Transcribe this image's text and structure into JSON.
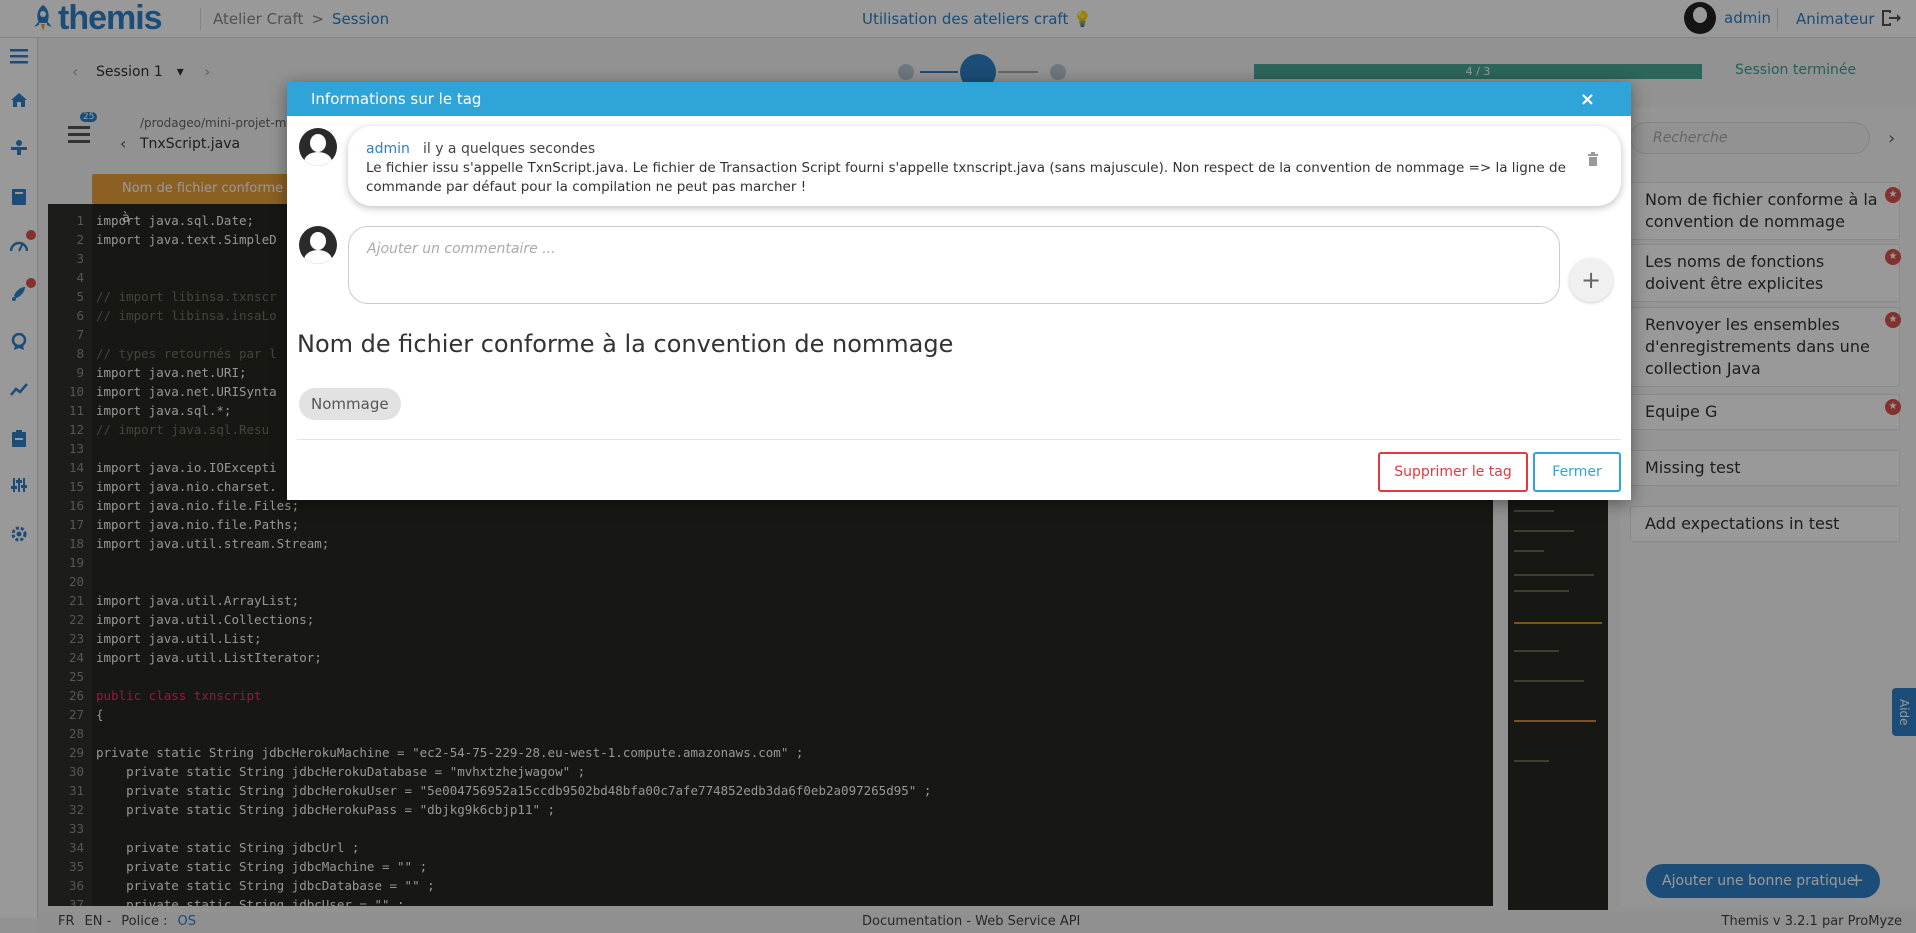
{
  "app": {
    "logo_text": "themis",
    "breadcrumb": [
      "Atelier Craft",
      ">",
      "Session"
    ],
    "center_title": "Utilisation des ateliers craft 💡",
    "user": "admin",
    "role": "Animateur"
  },
  "session": {
    "select_label": "Session 1",
    "progress_text": "4 / 3",
    "progress_value": 1.0,
    "status": "Session terminée"
  },
  "editor": {
    "file_path": "/prodageo/mini-projet-m",
    "file_name": "TnxScript.java",
    "tag_badge": "Nom de fichier conforme à",
    "file_count": "25",
    "lines": [
      {
        "n": "1",
        "t": "import java.sql.Date;",
        "k": "code"
      },
      {
        "n": "2",
        "t": "import java.text.SimpleD",
        "k": "code"
      },
      {
        "n": "3",
        "t": "",
        "k": "code"
      },
      {
        "n": "4",
        "t": "",
        "k": "code"
      },
      {
        "n": "5",
        "t": "// import libinsa.txnscr",
        "k": "comment"
      },
      {
        "n": "6",
        "t": "// import libinsa.insaLo",
        "k": "comment"
      },
      {
        "n": "7",
        "t": "",
        "k": "code"
      },
      {
        "n": "8",
        "t": "// types retournés par l",
        "k": "comment"
      },
      {
        "n": "9",
        "t": "import java.net.URI;",
        "k": "code"
      },
      {
        "n": "10",
        "t": "import java.net.URISynta",
        "k": "code"
      },
      {
        "n": "11",
        "t": "import java.sql.*;",
        "k": "code"
      },
      {
        "n": "12",
        "t": "// import java.sql.Resu",
        "k": "comment"
      },
      {
        "n": "13",
        "t": "",
        "k": "code"
      },
      {
        "n": "14",
        "t": "import java.io.IOExcepti",
        "k": "code"
      },
      {
        "n": "15",
        "t": "import java.nio.charset.",
        "k": "code"
      },
      {
        "n": "16",
        "t": "import java.nio.file.Files;",
        "k": "code"
      },
      {
        "n": "17",
        "t": "import java.nio.file.Paths;",
        "k": "code"
      },
      {
        "n": "18",
        "t": "import java.util.stream.Stream;",
        "k": "code"
      },
      {
        "n": "19",
        "t": "",
        "k": "code"
      },
      {
        "n": "20",
        "t": "",
        "k": "code"
      },
      {
        "n": "21",
        "t": "import java.util.ArrayList;",
        "k": "code"
      },
      {
        "n": "22",
        "t": "import java.util.Collections;",
        "k": "code"
      },
      {
        "n": "23",
        "t": "import java.util.List;",
        "k": "code"
      },
      {
        "n": "24",
        "t": "import java.util.ListIterator;",
        "k": "code"
      },
      {
        "n": "25",
        "t": "",
        "k": "code"
      },
      {
        "n": "26",
        "t": "public class txnscript",
        "k": "kw"
      },
      {
        "n": "27",
        "t": "{",
        "k": "code"
      },
      {
        "n": "28",
        "t": "",
        "k": "code"
      },
      {
        "n": "29",
        "t": "private static String jdbcHerokuMachine = \"ec2-54-75-229-28.eu-west-1.compute.amazonaws.com\" ;",
        "k": "code"
      },
      {
        "n": "30",
        "t": "    private static String jdbcHerokuDatabase = \"mvhxtzhejwagow\" ;",
        "k": "code"
      },
      {
        "n": "31",
        "t": "    private static String jdbcHerokuUser = \"5e004756952a15ccdb9502bd48bfa00c7afe774852edb3da6f0eb2a097265d95\" ;",
        "k": "code"
      },
      {
        "n": "32",
        "t": "    private static String jdbcHerokuPass = \"dbjkg9k6cbjp11\" ;",
        "k": "code"
      },
      {
        "n": "33",
        "t": "",
        "k": "code"
      },
      {
        "n": "34",
        "t": "    private static String jdbcUrl ;",
        "k": "code"
      },
      {
        "n": "35",
        "t": "    private static String jdbcMachine = \"\" ;",
        "k": "code"
      },
      {
        "n": "36",
        "t": "    private static String jdbcDatabase = \"\" ;",
        "k": "code"
      },
      {
        "n": "37",
        "t": "    private static String jdbcUser = \"\" ;",
        "k": "code"
      }
    ]
  },
  "right_panel": {
    "search_placeholder": "Recherche",
    "practices": [
      {
        "label": "Nom de fichier conforme à la convention de nommage",
        "starred": true
      },
      {
        "label": "Les noms de fonctions doivent être explicites",
        "starred": true
      },
      {
        "label": "Renvoyer les ensembles d'enregistrements dans une collection Java",
        "starred": true
      },
      {
        "label": "Equipe G",
        "starred": true
      },
      {
        "label": "Missing test",
        "starred": false
      },
      {
        "label": "Add expectations in test",
        "starred": false
      }
    ],
    "add_button": "Ajouter une bonne pratique",
    "help_tab": "Aide"
  },
  "footer": {
    "lang_fr": "FR",
    "lang_en": "EN -",
    "font_label": "Police :",
    "font_value": "OS",
    "doc_link": "Documentation - Web Service API",
    "version": "Themis v 3.2.1 par ProMyze"
  },
  "modal": {
    "title": "Informations sur le tag",
    "close_symbol": "×",
    "comment": {
      "author": "admin",
      "time": "il y a quelques secondes",
      "text": "Le fichier issu s'appelle TxnScript.java. Le fichier de Transaction Script fourni s'appelle txnscript.java (sans majuscule). Non respect de la convention de nommage => la ligne de commande par défaut pour la compilation ne peut pas marcher !"
    },
    "comment_placeholder": "Ajouter un commentaire ...",
    "add_symbol": "+",
    "tag_title": "Nom de fichier conforme à la convention de nommage",
    "tag_label": "Nommage",
    "delete_button": "Supprimer le tag",
    "close_button": "Fermer"
  },
  "colors": {
    "brand": "#2d80c9",
    "modal_header": "#2fa4d8",
    "danger": "#e0393e",
    "progress": "#4aa99a"
  },
  "icons": {
    "sidebar": [
      "menu-icon",
      "home-icon",
      "session-icon",
      "book-icon",
      "gauge-icon",
      "rocket-icon",
      "award-icon",
      "chart-icon",
      "clipboard-icon",
      "sliders-icon",
      "settings-icon"
    ]
  }
}
